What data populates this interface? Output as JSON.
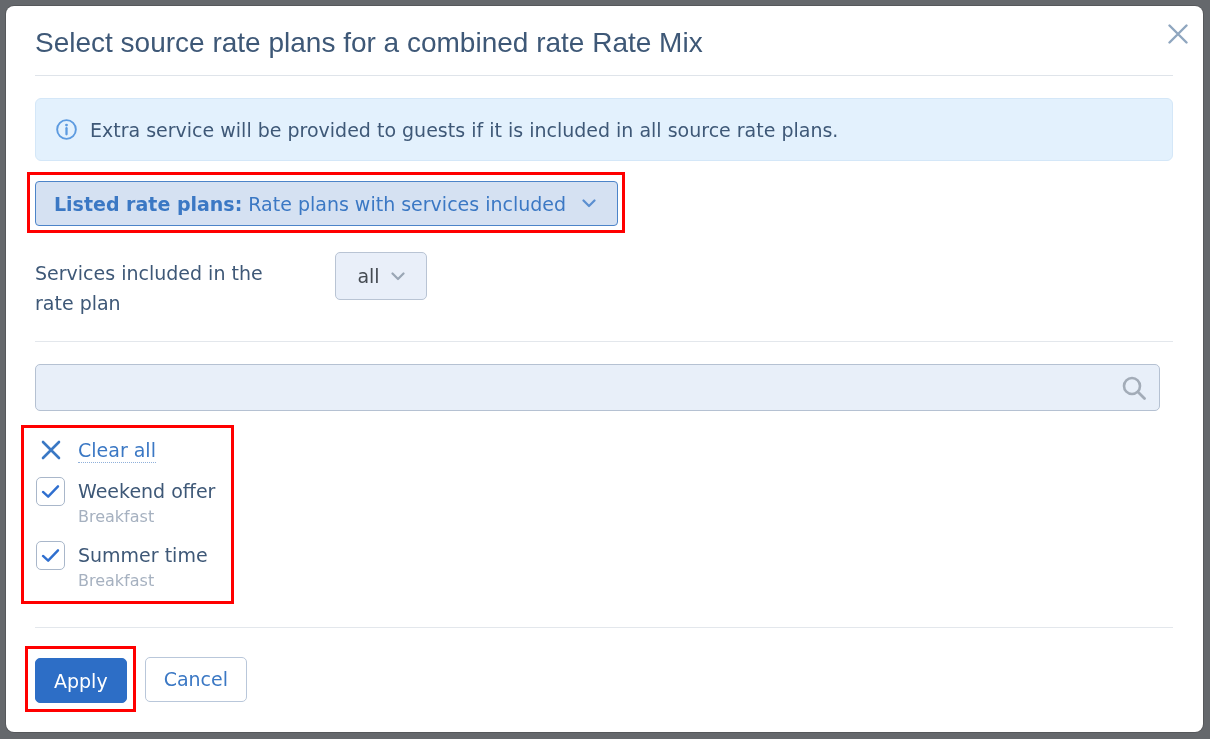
{
  "dialog": {
    "title": "Select source rate plans for a combined rate Rate Mix"
  },
  "info_banner": {
    "text": "Extra service will be provided to guests if it is included in all source rate plans."
  },
  "listed_filter": {
    "label": "Listed rate plans:",
    "value": "Rate plans with services included",
    "highlighted": true
  },
  "services_filter": {
    "label": "Services included in the rate plan",
    "value": "all"
  },
  "rate_plan_list": {
    "highlighted": true,
    "clear_label": "Clear all",
    "items": [
      {
        "name": "Weekend offer",
        "services": "Breakfast",
        "checked": true
      },
      {
        "name": "Summer time",
        "services": "Breakfast",
        "checked": true
      }
    ]
  },
  "buttons": [
    {
      "label": "Apply",
      "kind": "primary",
      "highlighted": true
    },
    {
      "label": "Cancel",
      "kind": "secondary",
      "highlighted": false
    }
  ]
}
